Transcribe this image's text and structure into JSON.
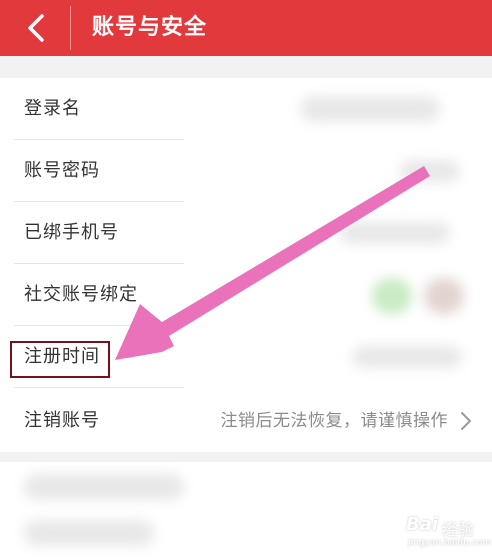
{
  "header": {
    "title": "账号与安全",
    "back_icon": "chevron-left-icon"
  },
  "rows": [
    {
      "label": "登录名"
    },
    {
      "label": "账号密码"
    },
    {
      "label": "已绑手机号"
    },
    {
      "label": "社交账号绑定"
    },
    {
      "label": "注册时间"
    },
    {
      "label": "注销账号",
      "value": "注销后无法恢复，请谨慎操作"
    }
  ],
  "annotation": {
    "arrow_color": "#e86ab6",
    "box_color": "#7a0f1b"
  },
  "watermark": {
    "brand": "Bai",
    "suffix": "经验",
    "url": "jingyan.baidu.com"
  },
  "colors": {
    "header": "#e2393d"
  }
}
